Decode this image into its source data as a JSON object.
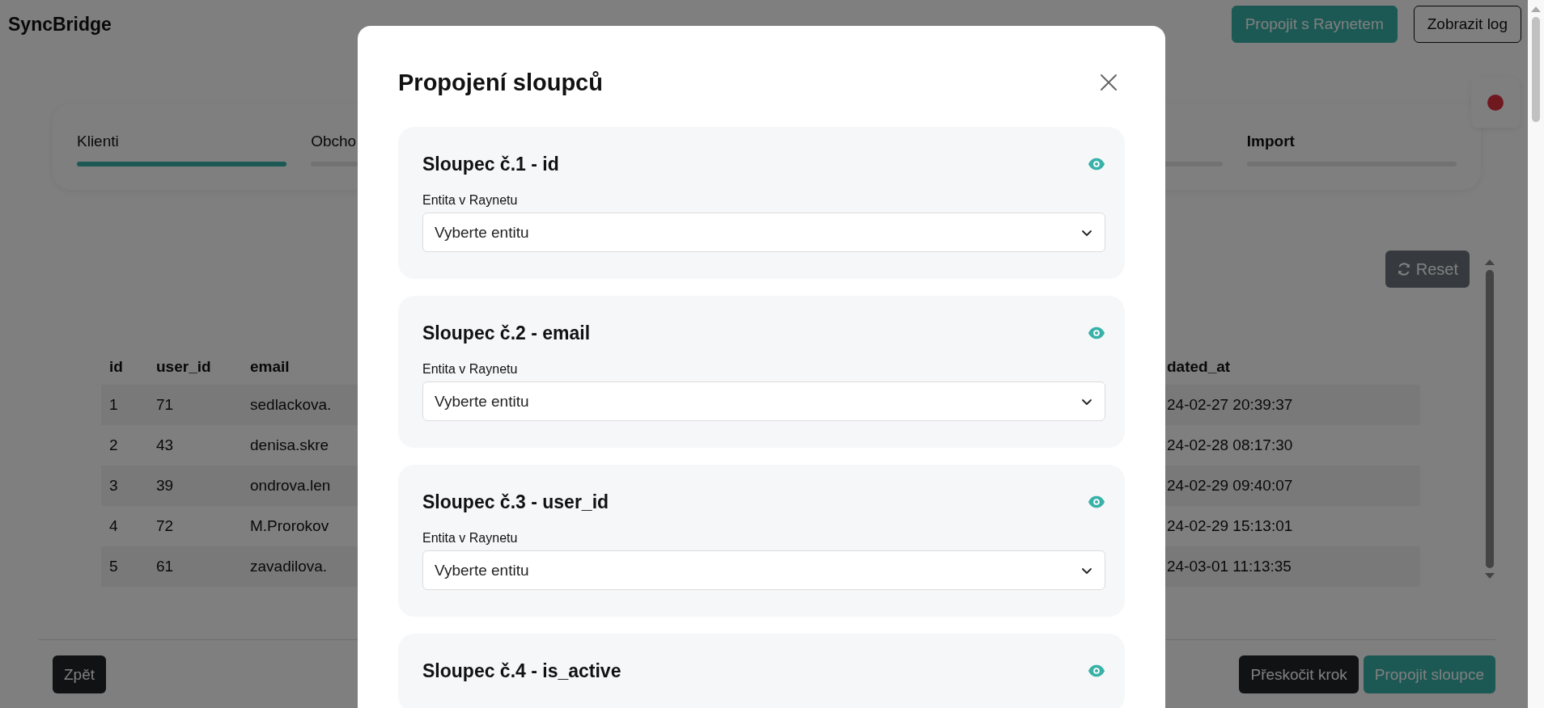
{
  "app": {
    "title": "SyncBridge"
  },
  "header_buttons": [
    {
      "label": "Propojit s Raynetem",
      "kind": "primary"
    },
    {
      "label": "Zobrazit log",
      "kind": "outline"
    }
  ],
  "status": {
    "connected": false
  },
  "steps": [
    {
      "label": "Klienti",
      "selected": true,
      "emphasized": false
    },
    {
      "label": "Obcho",
      "selected": false,
      "emphasized": false
    },
    {
      "selected": false
    },
    {
      "label": "Import",
      "selected": false,
      "emphasized": true
    }
  ],
  "reset_button": {
    "label": "Reset"
  },
  "table": {
    "columns": [
      "id",
      "user_id",
      "email",
      "dated_at"
    ],
    "rows": [
      [
        "1",
        "71",
        "sedlackova.",
        "24-02-27 20:39:37"
      ],
      [
        "2",
        "43",
        "denisa.skre",
        "24-02-28 08:17:30"
      ],
      [
        "3",
        "39",
        "ondrova.len",
        "24-02-29 09:40:07"
      ],
      [
        "4",
        "72",
        "M.Prorokov",
        "24-02-29 15:13:01"
      ],
      [
        "5",
        "61",
        "zavadilova.",
        "24-03-01 11:13:35"
      ]
    ]
  },
  "footer": {
    "back": "Zpět",
    "skip": "Přeskočit krok",
    "submit": "Propojit sloupce"
  },
  "modal": {
    "title": "Propojení sloupců",
    "columns": [
      {
        "title": "Sloupec č.1 - id",
        "visible": true,
        "label": "Entita v Raynetu",
        "placeholder": "Vyberte entitu"
      },
      {
        "title": "Sloupec č.2 - email",
        "visible": true,
        "label": "Entita v Raynetu",
        "placeholder": "Vyberte entitu"
      },
      {
        "title": "Sloupec č.3 - user_id",
        "visible": true,
        "label": "Entita v Raynetu",
        "placeholder": "Vyberte entitu"
      },
      {
        "title": "Sloupec č.4 - is_active",
        "visible": true
      }
    ]
  }
}
